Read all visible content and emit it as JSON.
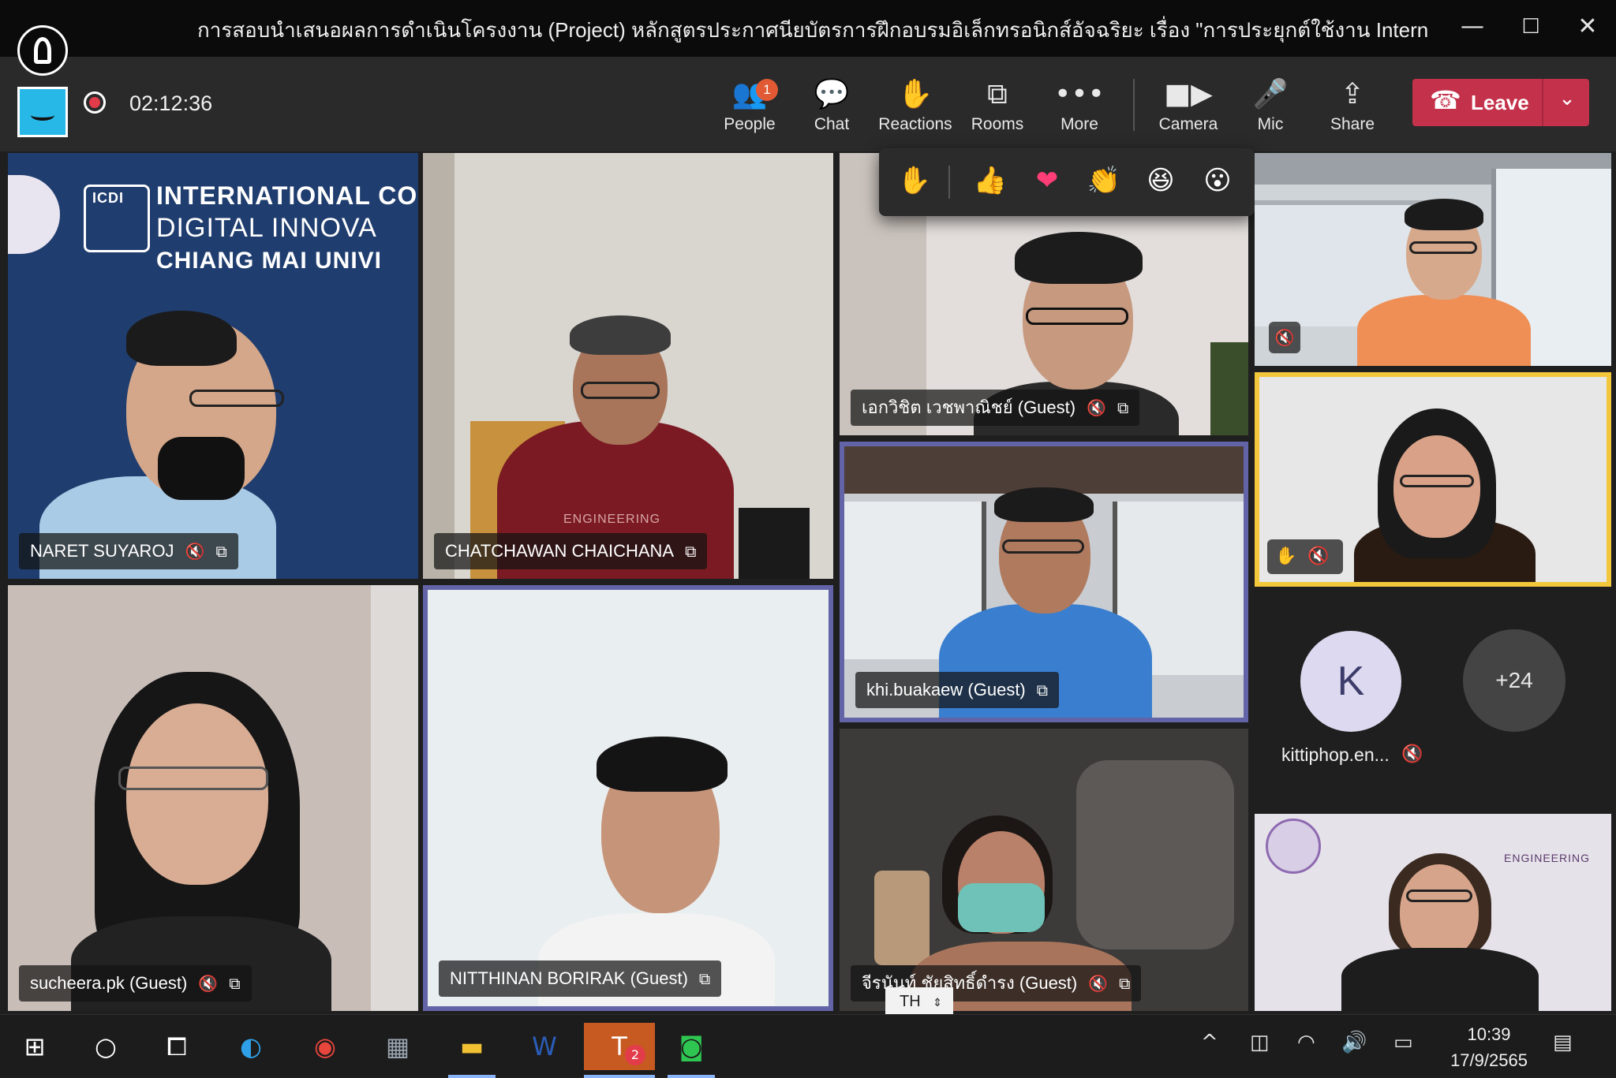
{
  "window": {
    "title": "การสอบนำเสนอผลการดำเนินโครงงาน (Project) หลักสูตรประกาศนียบัตรการฝึกอบรมอิเล็กทรอนิกส์อัจฉริยะ เรื่อง \"การประยุกต์ใช้งาน Interne...",
    "minimize": "—",
    "maximize": "☐",
    "close": "✕"
  },
  "toolbar": {
    "timer": "02:12:36",
    "people_label": "People",
    "people_badge": "1",
    "chat_label": "Chat",
    "reactions_label": "Reactions",
    "rooms_label": "Rooms",
    "more_label": "More",
    "camera_label": "Camera",
    "mic_label": "Mic",
    "share_label": "Share",
    "leave_label": "Leave"
  },
  "reactions": [
    "✋",
    "👍",
    "❤",
    "👏",
    "😆",
    "😮"
  ],
  "participants": [
    {
      "name": "NARET SUYAROJ"
    },
    {
      "name": "CHATCHAWAN CHAICHANA"
    },
    {
      "name": "เอกวิชิต เวชพาณิชย์ (Guest)"
    },
    {
      "name": "khi.buakaew (Guest)"
    },
    {
      "name": "sucheera.pk (Guest)"
    },
    {
      "name": "NITTHINAN BORIRAK (Guest)"
    },
    {
      "name": "จีรนันท์ ชัยสิทธิ์ดำรง (Guest)"
    }
  ],
  "backdrop": {
    "line1": "INTERNATIONAL CO",
    "line2": "DIGITAL INNOVA",
    "line3": "CHIANG MAI UNIVI",
    "logo": "ICDI",
    "shirt_text": "ENGINEERING",
    "eng_banner": "ENGINEERING"
  },
  "overflow": {
    "avatar_initial": "K",
    "avatar_name": "kittiphop.en...",
    "more_count": "+24"
  },
  "ime": {
    "lang": "TH"
  },
  "taskbar": {
    "time": "10:39",
    "date": "17/9/2565",
    "teams_badge": "2"
  }
}
